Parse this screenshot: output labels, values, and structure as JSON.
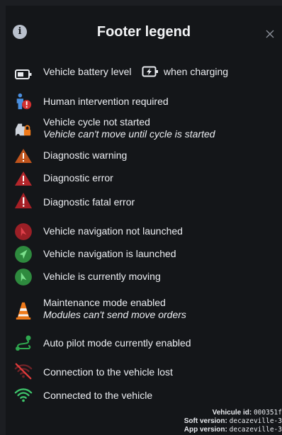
{
  "header": {
    "title": "Footer legend",
    "info_icon": "i"
  },
  "legend": {
    "battery": {
      "label": "Vehicle battery level",
      "suffix": "when charging"
    },
    "human_intervention": "Human intervention required",
    "cycle_not_started": "Vehicle cycle not started",
    "cycle_not_started_note": "Vehicle can't move until cycle is started",
    "diagnostic_warning": "Diagnostic warning",
    "diagnostic_error": "Diagnostic error",
    "diagnostic_fatal": "Diagnostic fatal error",
    "nav_not_launched": "Vehicle navigation not launched",
    "nav_launched": "Vehicle navigation is launched",
    "moving": "Vehicle is currently moving",
    "maintenance": "Maintenance mode enabled",
    "maintenance_note": "Modules can't send move orders",
    "autopilot": "Auto pilot mode currently enabled",
    "connection_lost": "Connection to the vehicle lost",
    "connected": "Connected to the vehicle"
  },
  "footer": {
    "vehicle_id_label": "Vehicule id:",
    "vehicle_id_value": "000351f",
    "soft_version_label": "Soft version:",
    "soft_version_value": "decazeville-3",
    "app_version_label": "App version:",
    "app_version_value": "decazeville-3"
  },
  "colors": {
    "warning": "#c0541c",
    "error": "#b3262b",
    "nav_not_launched": "#9b1f26",
    "nav_launched": "#2e8a3e",
    "autopilot": "#2fa84f",
    "wifi": "#3ec46b",
    "cone": "#f07a1a",
    "human": "#4a8fe0",
    "lost": "#d63a3a"
  }
}
